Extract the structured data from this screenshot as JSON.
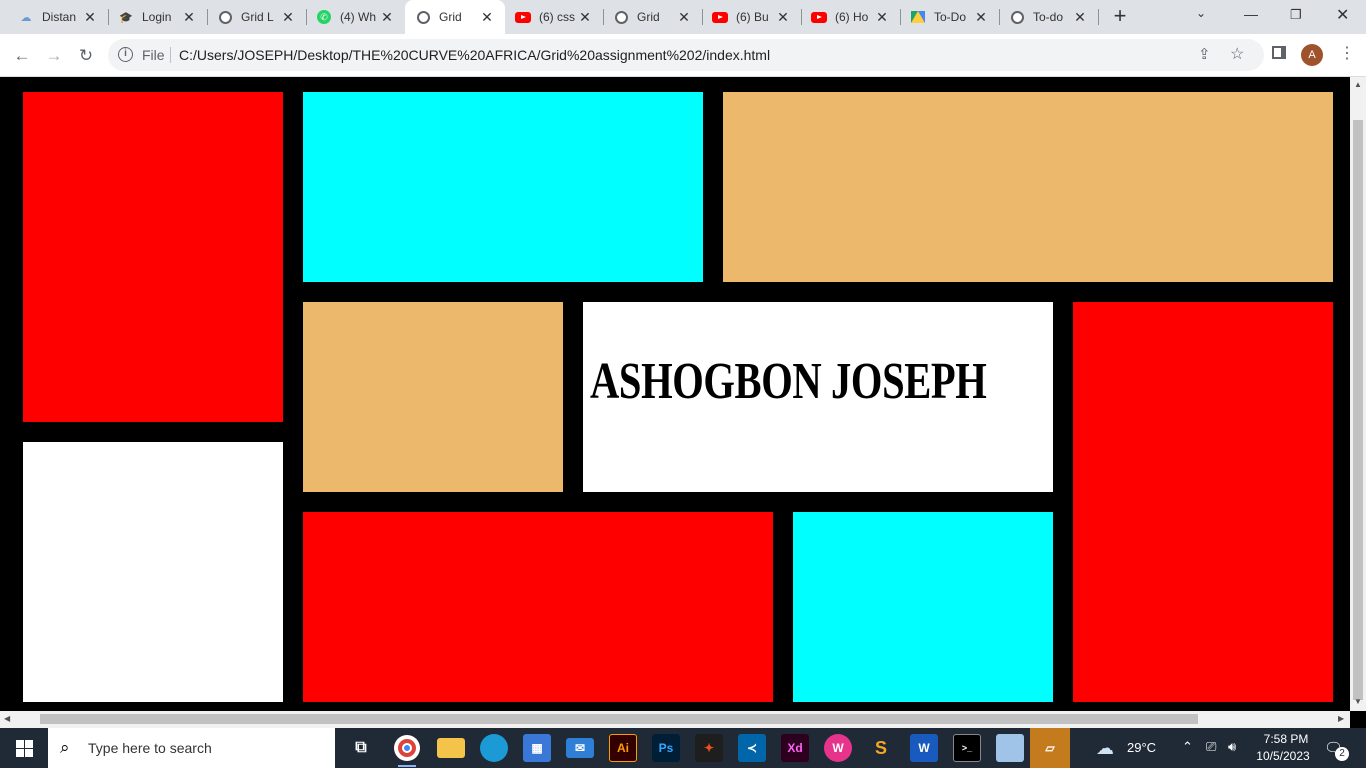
{
  "tabs": [
    {
      "title": "Distan",
      "icon": "distance-learning-icon"
    },
    {
      "title": "Login",
      "icon": "graduation-cap-icon"
    },
    {
      "title": "Grid L",
      "icon": "globe-icon"
    },
    {
      "title": "(4) Wh",
      "icon": "whatsapp-icon"
    },
    {
      "title": "Grid",
      "icon": "globe-icon"
    },
    {
      "title": "(6) css",
      "icon": "youtube-icon"
    },
    {
      "title": "Grid",
      "icon": "globe-icon"
    },
    {
      "title": "(6) Bu",
      "icon": "youtube-icon"
    },
    {
      "title": "(6) Ho",
      "icon": "youtube-icon"
    },
    {
      "title": "To-Do",
      "icon": "google-drive-icon"
    },
    {
      "title": "To-do",
      "icon": "globe-icon"
    }
  ],
  "active_tab_index": 4,
  "toolbar": {
    "file_label": "File",
    "url": "C:/Users/JOSEPH/Desktop/THE%20CURVE%20AFRICA/Grid%20assignment%202/index.html",
    "avatar_letter": "A"
  },
  "page": {
    "heading": "ASHOGBON JOSEPH",
    "colors": {
      "red": "#ff0000",
      "cyan": "#00ffff",
      "tan": "#ecb86b",
      "white": "#ffffff",
      "background": "#000000"
    }
  },
  "taskbar": {
    "search_placeholder": "Type here to search",
    "weather_temp": "29°C",
    "time": "7:58 PM",
    "date": "10/5/2023",
    "notification_count": "2",
    "apps": [
      "Ai",
      "Ps",
      "Xd",
      "W"
    ]
  }
}
